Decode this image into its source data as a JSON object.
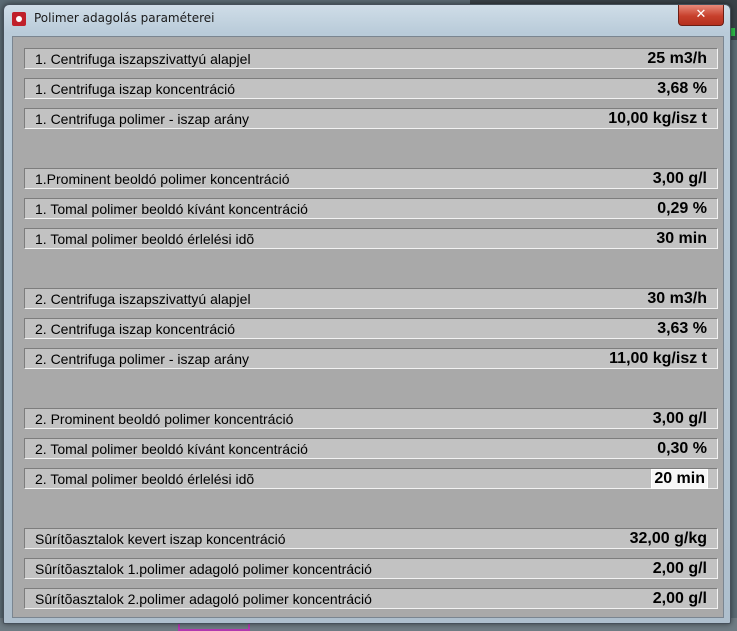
{
  "window": {
    "title": "Polimer adagolás paraméterei",
    "close_symbol": "✕"
  },
  "rows": [
    {
      "label": "1. Centrifuga iszapszivattyú alapjel",
      "value": "25 m3/h"
    },
    {
      "label": "1. Centrifuga iszap koncentráció",
      "value": "3,68 %"
    },
    {
      "label": "1. Centrifuga polimer - iszap arány",
      "value": "10,00 kg/isz t"
    },
    {
      "label": "1.Prominent beoldó polimer koncentráció",
      "value": "3,00 g/l"
    },
    {
      "label": "1. Tomal polimer beoldó kívánt koncentráció",
      "value": "0,29 %"
    },
    {
      "label": "1. Tomal polimer beoldó érlelési idõ",
      "value": "30 min"
    },
    {
      "label": "2. Centrifuga iszapszivattyú alapjel",
      "value": "30 m3/h"
    },
    {
      "label": "2. Centrifuga iszap koncentráció",
      "value": "3,63 %"
    },
    {
      "label": "2. Centrifuga polimer - iszap arány",
      "value": "11,00 kg/isz t"
    },
    {
      "label": "2. Prominent beoldó polimer koncentráció",
      "value": "3,00 g/l"
    },
    {
      "label": "2. Tomal polimer beoldó kívánt koncentráció",
      "value": "0,30 %"
    },
    {
      "label": "2. Tomal polimer beoldó érlelési idõ",
      "value": "20 min"
    },
    {
      "label": "Sûrítõasztalok kevert iszap koncentráció",
      "value": "32,00 g/kg"
    },
    {
      "label": "Sûrítõasztalok 1.polimer adagoló polimer koncentráció",
      "value": "2,00 g/l"
    },
    {
      "label": "Sûrítõasztalok 2.polimer adagoló polimer koncentráció",
      "value": "2,00 g/l"
    }
  ]
}
